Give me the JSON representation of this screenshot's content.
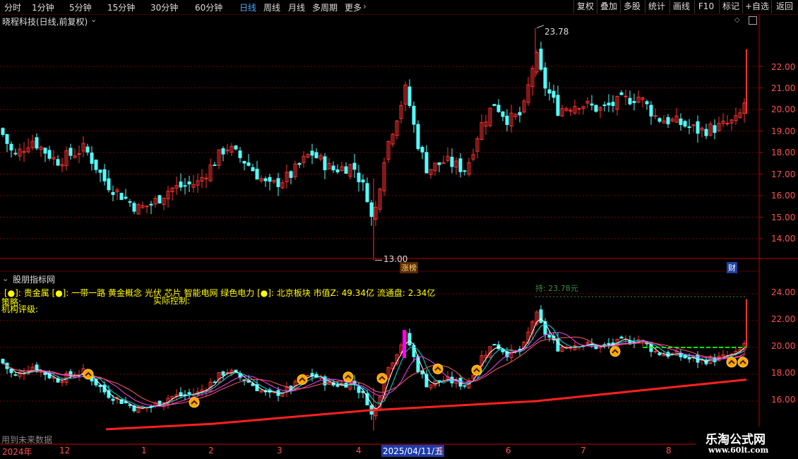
{
  "toolbar": {
    "periods": [
      "分时",
      "1分钟",
      "5分钟",
      "15分钟",
      "30分钟",
      "60分钟",
      "日线",
      "周线",
      "月线",
      "多周期",
      "更多"
    ],
    "active_period": "日线",
    "more_arrow": "›",
    "actions": [
      "复权",
      "叠加",
      "多股",
      "统计",
      "画线",
      "F10",
      "标记",
      "+自选",
      "返回"
    ]
  },
  "main_chart": {
    "title": "晓程科技(日线,前复权)",
    "y_ticks": [
      "22.00",
      "21.00",
      "20.00",
      "19.00",
      "18.00",
      "17.00",
      "16.00",
      "15.00",
      "14.00"
    ],
    "high_label": "23.78",
    "low_label": "13.00",
    "badge_limit": "涨榜",
    "badge_finance": "财"
  },
  "indicator_panel": {
    "title": "股朋指标网",
    "concept_line_1": "[●]: 贵金属    [●]: 一带一路 黄金概念 光伏 芯片 智能电网 绿色电力    [●]: 北京板块     市值Z:  49.34亿     流通盘:  2.34亿",
    "strategy_label": "策略:",
    "control_label": "实际控制:",
    "rating_label": "机构评级:",
    "faint_label": "持: 23.78元",
    "future_data_label": "用到未来数据",
    "y_ticks": [
      "24.00",
      "22.00",
      "20.00",
      "18.00",
      "16.00"
    ]
  },
  "time_axis": {
    "labels": [
      "2024年",
      "12",
      "1",
      "2",
      "3",
      "4",
      "5",
      "6",
      "7",
      "8"
    ],
    "cursor_date": "2025/04/11/五"
  },
  "watermark": {
    "name": "乐淘公式网",
    "url": "www.60lt.com"
  },
  "colors": {
    "up": "#ff3232",
    "down": "#54ffff",
    "grid": "#7a0000",
    "frame": "#c00000",
    "yellow": "#ffff00",
    "magenta": "#ff00ff",
    "ma_white": "#ffffff",
    "ma_cyan": "#00e0e0",
    "ma_purple": "#ff40ff",
    "trend_red": "#ff2020",
    "green_dash": "#00ff00",
    "signal_orange": "#ffa500"
  },
  "icons": [
    "chevron-down-icon",
    "chevron-right-icon",
    "diamond-icon",
    "layout-icon",
    "signal-arrow-icon"
  ]
}
